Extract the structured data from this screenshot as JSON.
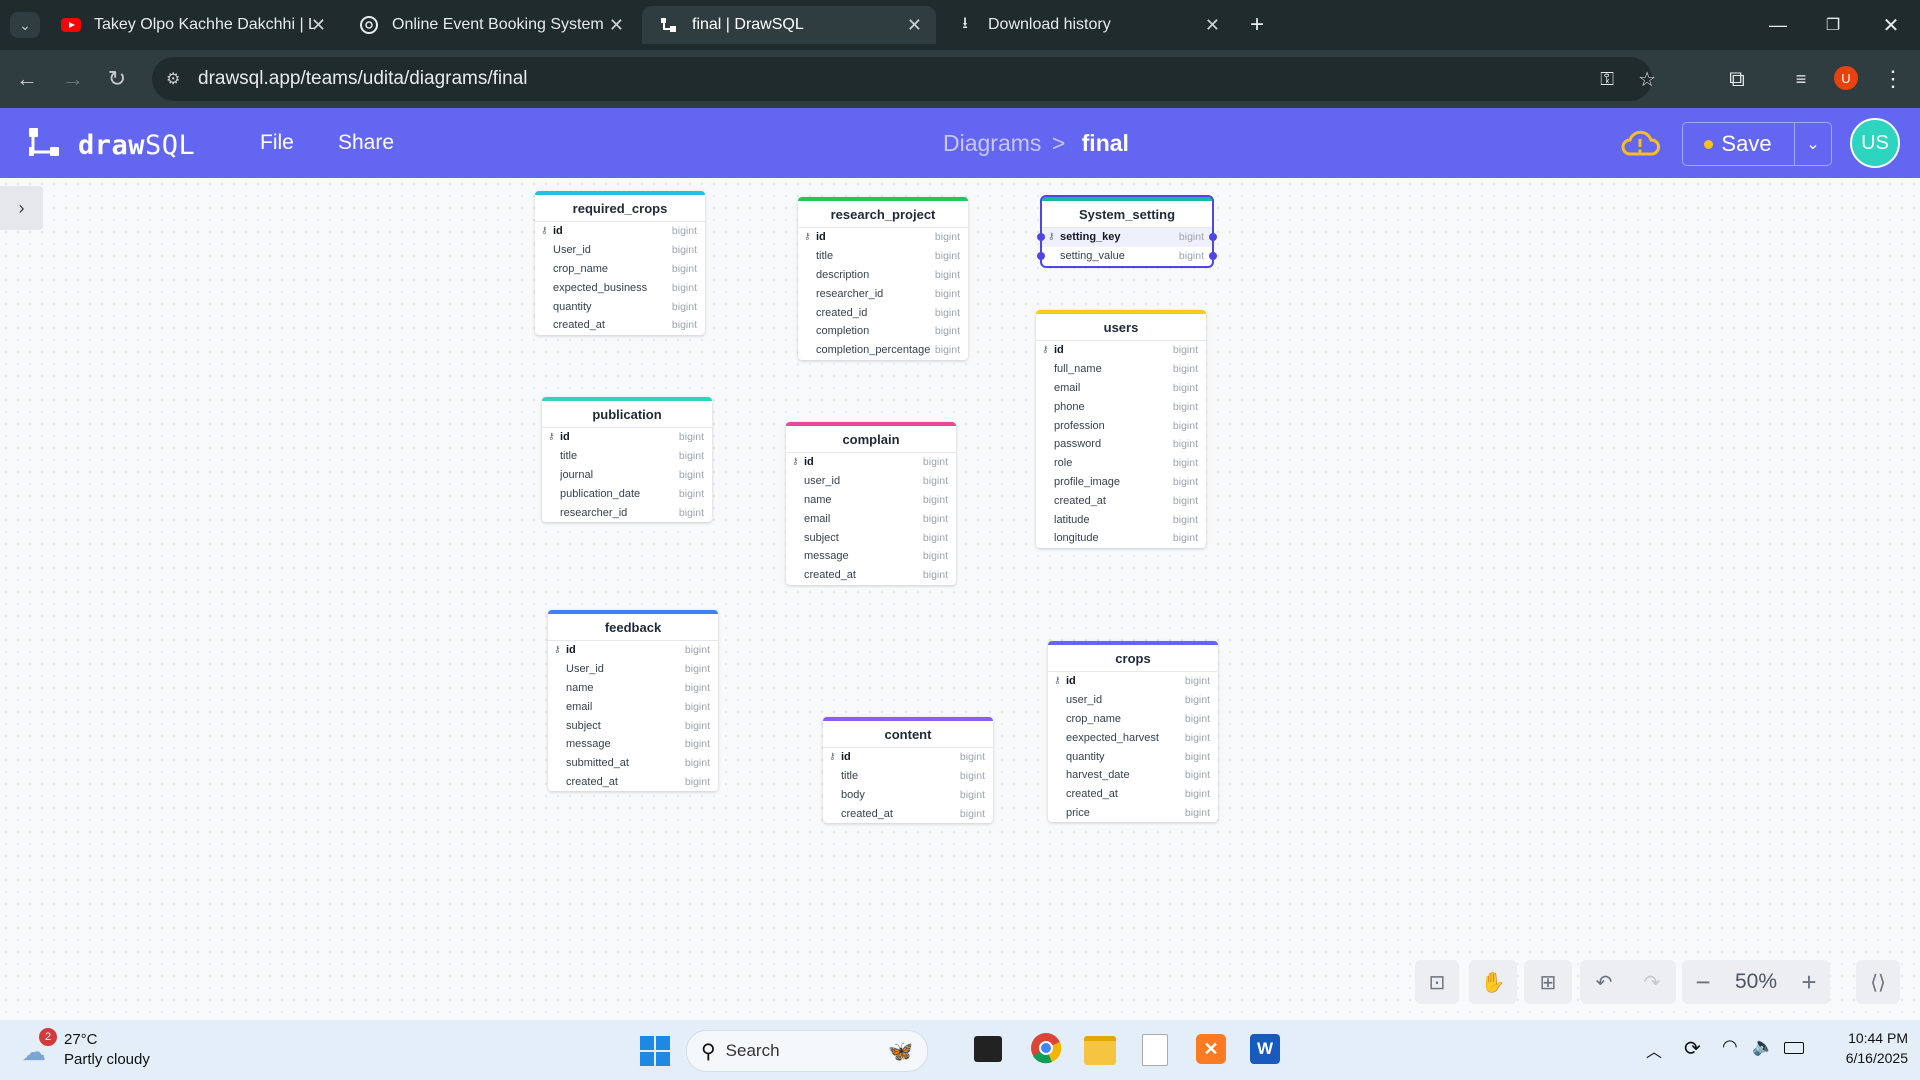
{
  "browser": {
    "tabs": [
      {
        "title": "Takey Olpo Kachhe Dakchhi | Ly"
      },
      {
        "title": "Online Event Booking System"
      },
      {
        "title": "final | DrawSQL"
      },
      {
        "title": "Download history"
      }
    ],
    "url": "drawsql.app/teams/udita/diagrams/final",
    "profile_initial": "U"
  },
  "app": {
    "logo_a": "draw",
    "logo_b": "SQL",
    "menu_file": "File",
    "menu_share": "Share",
    "breadcrumb_parent": "Diagrams",
    "breadcrumb_sep": ">",
    "breadcrumb_current": "final",
    "save_label": "Save",
    "avatar": "US",
    "accent": "#6366f1"
  },
  "tables": [
    {
      "name": "required_crops",
      "color": "#22c1dc",
      "columns": [
        [
          "id",
          "bigint"
        ],
        [
          "User_id",
          "bigint"
        ],
        [
          "crop_name",
          "bigint"
        ],
        [
          "expected_business",
          "bigint"
        ],
        [
          "quantity",
          "bigint"
        ],
        [
          "created_at",
          "bigint"
        ]
      ]
    },
    {
      "name": "research_project",
      "color": "#22c55e",
      "columns": [
        [
          "id",
          "bigint"
        ],
        [
          "title",
          "bigint"
        ],
        [
          "description",
          "bigint"
        ],
        [
          "researcher_id",
          "bigint"
        ],
        [
          "created_id",
          "bigint"
        ],
        [
          "completion",
          "bigint"
        ],
        [
          "completion_percentage",
          "bigint"
        ]
      ]
    },
    {
      "name": "System_setting",
      "color": "#14b8a6",
      "columns": [
        [
          "setting_key",
          "bigint"
        ],
        [
          "setting_value",
          "bigint"
        ]
      ]
    },
    {
      "name": "users",
      "color": "#facc15",
      "columns": [
        [
          "id",
          "bigint"
        ],
        [
          "full_name",
          "bigint"
        ],
        [
          "email",
          "bigint"
        ],
        [
          "phone",
          "bigint"
        ],
        [
          "profession",
          "bigint"
        ],
        [
          "password",
          "bigint"
        ],
        [
          "role",
          "bigint"
        ],
        [
          "profile_image",
          "bigint"
        ],
        [
          "created_at",
          "bigint"
        ],
        [
          "latitude",
          "bigint"
        ],
        [
          "longitude",
          "bigint"
        ]
      ]
    },
    {
      "name": "publication",
      "color": "#2dd4bf",
      "columns": [
        [
          "id",
          "bigint"
        ],
        [
          "title",
          "bigint"
        ],
        [
          "journal",
          "bigint"
        ],
        [
          "publication_date",
          "bigint"
        ],
        [
          "researcher_id",
          "bigint"
        ]
      ]
    },
    {
      "name": "complain",
      "color": "#ec4899",
      "columns": [
        [
          "id",
          "bigint"
        ],
        [
          "user_id",
          "bigint"
        ],
        [
          "name",
          "bigint"
        ],
        [
          "email",
          "bigint"
        ],
        [
          "subject",
          "bigint"
        ],
        [
          "message",
          "bigint"
        ],
        [
          "created_at",
          "bigint"
        ]
      ]
    },
    {
      "name": "feedback",
      "color": "#3b82f6",
      "columns": [
        [
          "id",
          "bigint"
        ],
        [
          "User_id",
          "bigint"
        ],
        [
          "name",
          "bigint"
        ],
        [
          "email",
          "bigint"
        ],
        [
          "subject",
          "bigint"
        ],
        [
          "message",
          "bigint"
        ],
        [
          "submitted_at",
          "bigint"
        ],
        [
          "created_at",
          "bigint"
        ]
      ]
    },
    {
      "name": "content",
      "color": "#8b5cf6",
      "columns": [
        [
          "id",
          "bigint"
        ],
        [
          "title",
          "bigint"
        ],
        [
          "body",
          "bigint"
        ],
        [
          "created_at",
          "bigint"
        ]
      ]
    },
    {
      "name": "crops",
      "color": "#6366f1",
      "columns": [
        [
          "id",
          "bigint"
        ],
        [
          "user_id",
          "bigint"
        ],
        [
          "crop_name",
          "bigint"
        ],
        [
          "eexpected_harvest",
          "bigint"
        ],
        [
          "quantity",
          "bigint"
        ],
        [
          "harvest_date",
          "bigint"
        ],
        [
          "created_at",
          "bigint"
        ],
        [
          "price",
          "bigint"
        ]
      ]
    }
  ],
  "zoom": "50%",
  "taskbar": {
    "weather_temp": "27°C",
    "weather_desc": "Partly cloudy",
    "weather_badge": "2",
    "search_label": "Search",
    "time": "10:44 PM",
    "date": "6/16/2025"
  }
}
